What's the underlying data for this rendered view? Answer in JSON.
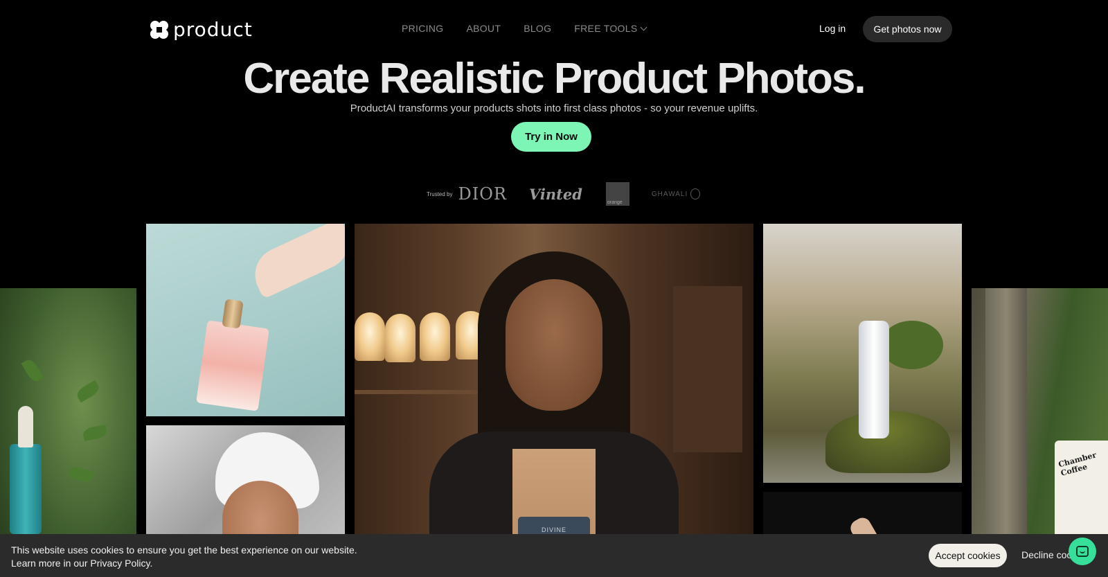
{
  "header": {
    "logo_text": "product",
    "nav": [
      {
        "label": "PRICING"
      },
      {
        "label": "ABOUT"
      },
      {
        "label": "BLOG"
      },
      {
        "label": "FREE TOOLS"
      }
    ],
    "login_label": "Log in",
    "cta_label": "Get photos now"
  },
  "hero": {
    "title": "Create Realistic Product Photos.",
    "subtitle": "ProductAI transforms your products shots into first class photos - so your revenue uplifts.",
    "cta_label": "Try in Now"
  },
  "trusted": {
    "label": "Trusted by",
    "brands": [
      "DIOR",
      "Vinted",
      "orange",
      "GHAWALI"
    ]
  },
  "photos": [
    {
      "name": "serum-bottle-photo"
    },
    {
      "name": "perfume-bottle-photo"
    },
    {
      "name": "towel-woman-photo"
    },
    {
      "name": "woman-holding-coffee-bag-photo",
      "bag_label": "DIVINE"
    },
    {
      "name": "forest-bottle-photo"
    },
    {
      "name": "dark-hand-photo"
    },
    {
      "name": "coffee-bag-photo",
      "bag_label": "Chamber Coffee"
    }
  ],
  "cookie": {
    "line1": "This website uses cookies to ensure you get the best experience on our website.",
    "line2": "Learn more in our Privacy Policy.",
    "accept_label": "Accept cookies",
    "decline_label": "Decline coo"
  },
  "colors": {
    "accent_green": "#7df5b5",
    "chat_green": "#37e09a",
    "background": "#000000"
  }
}
